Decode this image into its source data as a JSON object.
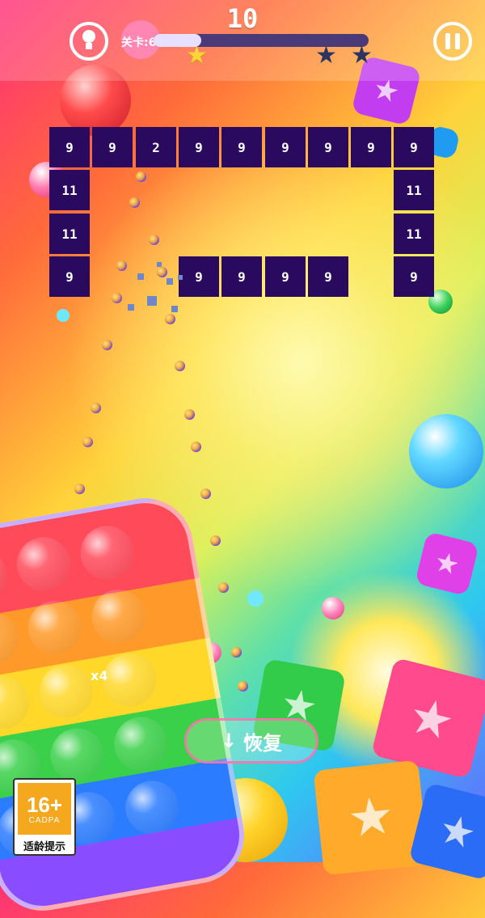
{
  "hud": {
    "score": "10",
    "level_label": "关卡:6",
    "progress_fraction": 0.22,
    "stars_earned": 1,
    "stars_total": 3,
    "hint_icon": "lightbulb-icon",
    "pause_icon": "pause-icon"
  },
  "bricks": [
    {
      "row": 0,
      "col": 0,
      "value": "9"
    },
    {
      "row": 0,
      "col": 1,
      "value": "9"
    },
    {
      "row": 0,
      "col": 2,
      "value": "2"
    },
    {
      "row": 0,
      "col": 3,
      "value": "9"
    },
    {
      "row": 0,
      "col": 4,
      "value": "9"
    },
    {
      "row": 0,
      "col": 5,
      "value": "9"
    },
    {
      "row": 0,
      "col": 6,
      "value": "9"
    },
    {
      "row": 0,
      "col": 7,
      "value": "9"
    },
    {
      "row": 0,
      "col": 8,
      "value": "9"
    },
    {
      "row": 1,
      "col": 0,
      "value": "11"
    },
    {
      "row": 1,
      "col": 8,
      "value": "11"
    },
    {
      "row": 2,
      "col": 0,
      "value": "11"
    },
    {
      "row": 2,
      "col": 8,
      "value": "11"
    },
    {
      "row": 3,
      "col": 0,
      "value": "9"
    },
    {
      "row": 3,
      "col": 3,
      "value": "9"
    },
    {
      "row": 3,
      "col": 4,
      "value": "9"
    },
    {
      "row": 3,
      "col": 5,
      "value": "9"
    },
    {
      "row": 3,
      "col": 6,
      "value": "9"
    },
    {
      "row": 3,
      "col": 8,
      "value": "9"
    }
  ],
  "ball_count_label": "x4",
  "restore_button": {
    "label": "恢复",
    "icon": "down-arrow-icon"
  },
  "age_badge": {
    "rating": "16+",
    "org": "CADPA",
    "caption": "适龄提示"
  },
  "colors": {
    "brick": "#2a0a5e",
    "star_gold": "#ffd43a",
    "star_dark": "#2c3560"
  }
}
